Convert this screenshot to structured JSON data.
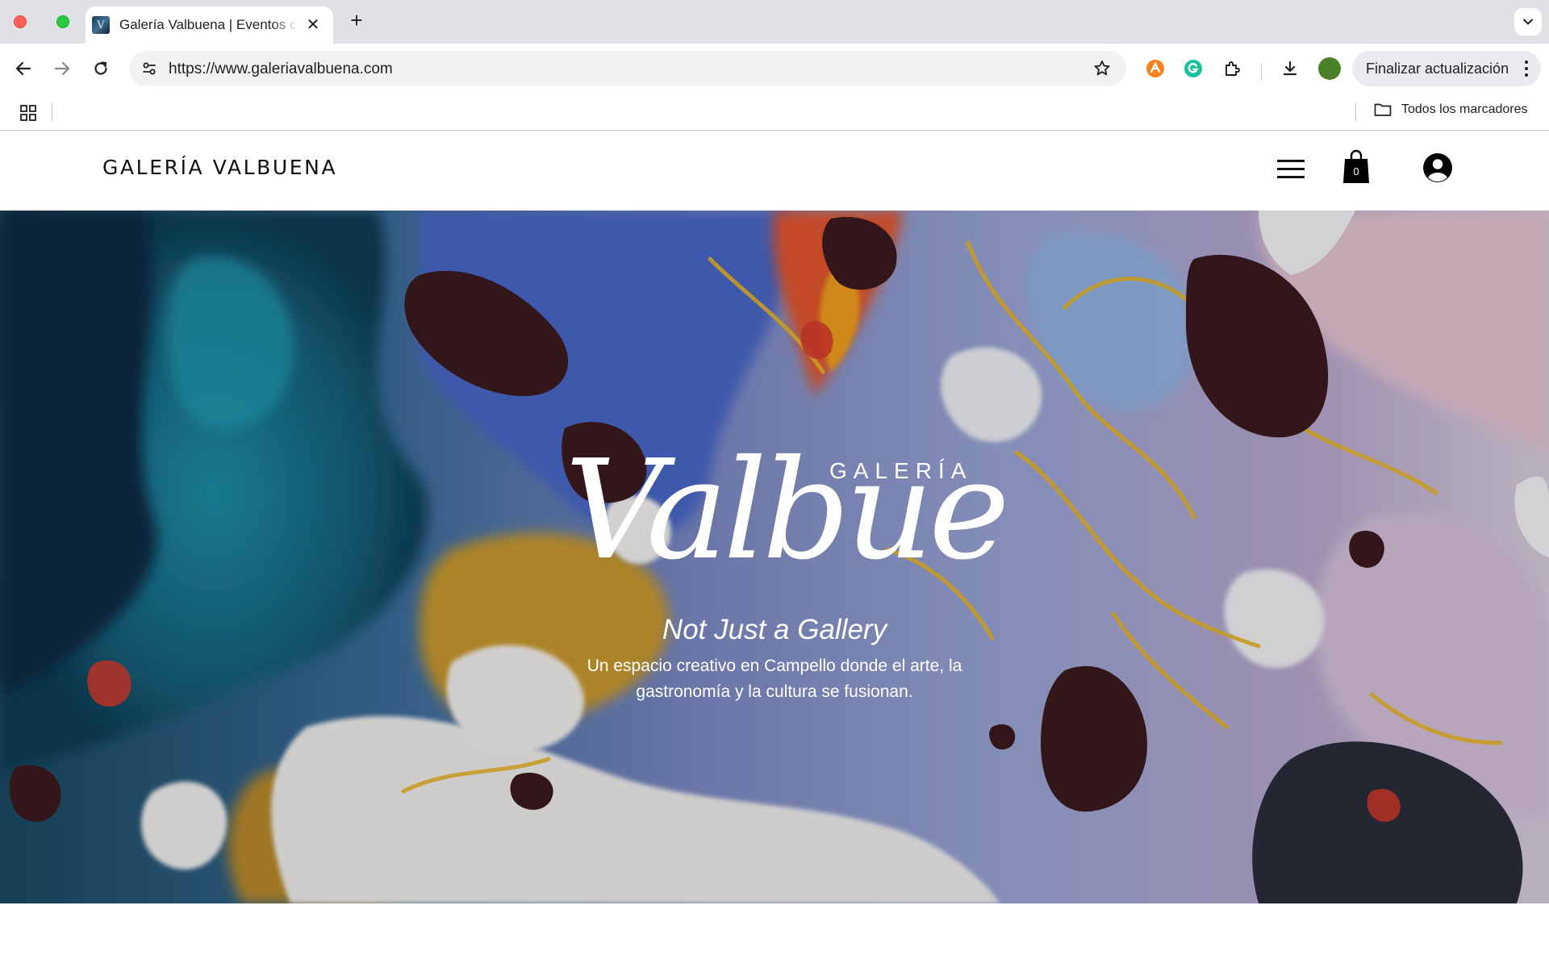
{
  "browser": {
    "tab": {
      "title": "Galería Valbuena | Eventos cu",
      "favicon_icon": "gallery-favicon-icon"
    },
    "url": "https://www.galeriavalbuena.com",
    "update_button": "Finalizar actualización",
    "bookmarks_all": "Todos los marcadores",
    "profile_color": "#4a7f2a"
  },
  "site": {
    "logo": "GALERÍA VALBUENA",
    "cart_count": "0"
  },
  "hero": {
    "galeria": "GALERÍA",
    "script_name": "Valbuena",
    "tagline": "Not Just a Gallery",
    "description": "Un espacio creativo en Campello donde el arte, la gastronomía y la cultura se fusionan."
  }
}
